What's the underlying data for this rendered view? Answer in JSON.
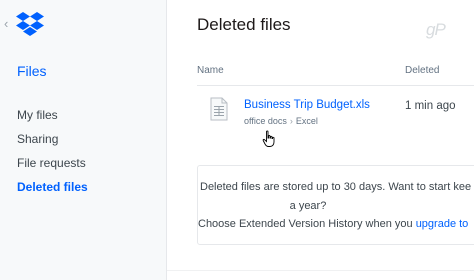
{
  "sidebar": {
    "title": "Files",
    "items": [
      {
        "label": "My files"
      },
      {
        "label": "Sharing"
      },
      {
        "label": "File requests"
      },
      {
        "label": "Deleted files"
      }
    ]
  },
  "main": {
    "title": "Deleted files",
    "watermark": "gP",
    "columns": {
      "name": "Name",
      "deleted": "Deleted"
    },
    "rows": [
      {
        "name": "Business Trip Budget.xls",
        "path": [
          "office docs",
          "Excel"
        ],
        "deleted": "1 min ago"
      }
    ],
    "notice": {
      "line1": "Deleted files are stored up to 30 days. Want to start kee",
      "line2": "a year?",
      "line3_text": "Choose Extended Version History when you ",
      "line3_link": "upgrade to"
    }
  },
  "colors": {
    "accent": "#0061fe",
    "text": "#3d464d",
    "muted": "#637282"
  },
  "icons": {
    "logo": "dropbox-logo-icon",
    "file": "spreadsheet-file-icon",
    "cursor": "hand-pointer-icon",
    "back": "chevron-left-icon"
  }
}
